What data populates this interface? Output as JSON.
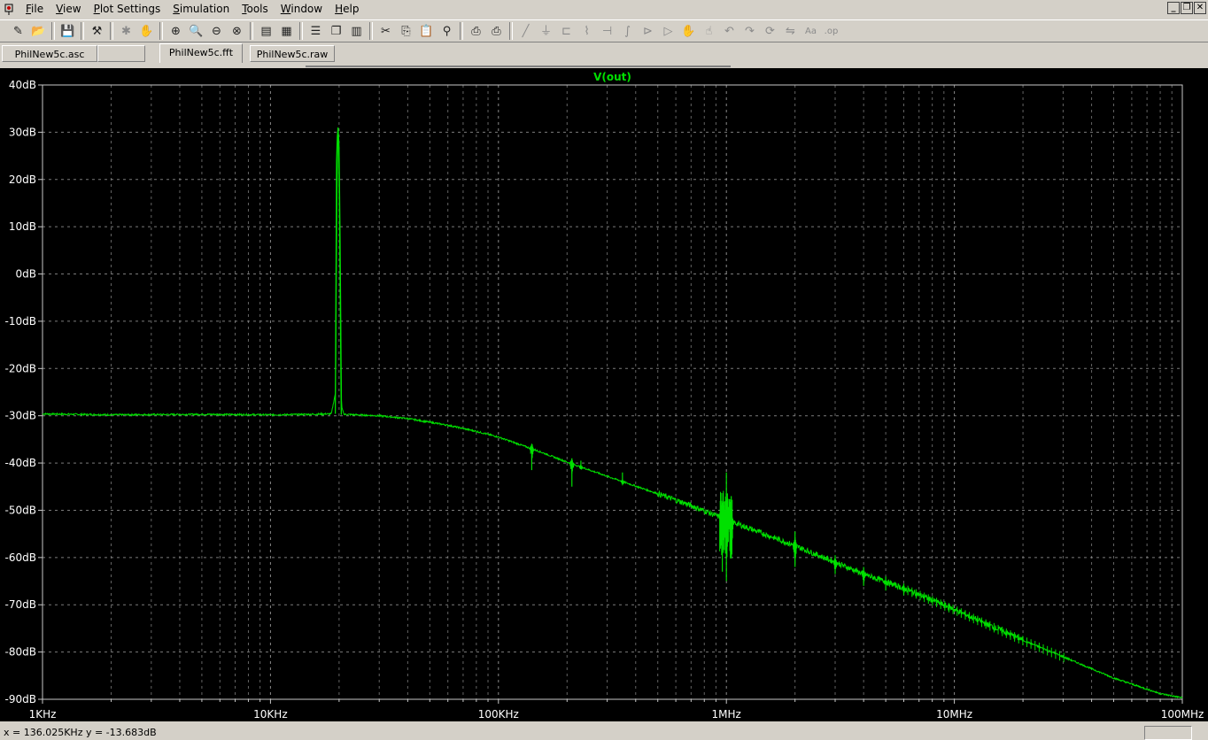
{
  "menu": {
    "items": [
      {
        "key": "F",
        "rest": "ile"
      },
      {
        "key": "V",
        "rest": "iew"
      },
      {
        "key": "P",
        "rest": "lot Settings"
      },
      {
        "key": "S",
        "rest": "imulation"
      },
      {
        "key": "T",
        "rest": "ools"
      },
      {
        "key": "W",
        "rest": "indow"
      },
      {
        "key": "H",
        "rest": "elp"
      }
    ]
  },
  "window_controls": [
    "_",
    "❐",
    "✕"
  ],
  "toolbar": {
    "icons": [
      "new-schematic-icon",
      "open-icon",
      "|",
      "save-icon",
      "|",
      "control-panel-icon",
      "|",
      "run-icon",
      "pan-icon",
      "|",
      "zoom-in-icon",
      "zoom-area-icon",
      "zoom-out-icon",
      "zoom-fit-icon",
      "|",
      "autorange-icon",
      "autorange-2-icon",
      "|",
      "tile-horizontal-icon",
      "cascade-icon",
      "tile-vertical-icon",
      "|",
      "cut-icon",
      "copy-icon",
      "paste-icon",
      "find-icon",
      "|",
      "print-setup-icon",
      "print-icon",
      "|",
      "wire-icon",
      "ground-icon",
      "label-icon",
      "resistor-icon",
      "capacitor-icon",
      "inductor-icon",
      "diode-icon",
      "component-icon",
      "move-icon",
      "drag-icon",
      "undo-icon",
      "redo-icon",
      "rotate-icon",
      "mirror-icon",
      "text-icon",
      "spice-directive-icon"
    ],
    "disabled_icons": [
      "run-icon",
      "pan-icon",
      "wire-icon",
      "ground-icon",
      "label-icon",
      "resistor-icon",
      "capacitor-icon",
      "inductor-icon",
      "diode-icon",
      "component-icon",
      "move-icon",
      "drag-icon",
      "undo-icon",
      "redo-icon",
      "rotate-icon",
      "mirror-icon",
      "text-icon",
      "spice-directive-icon"
    ]
  },
  "tabs": [
    {
      "label": "PhilNew5c.asc",
      "active": false
    },
    {
      "label": "",
      "active": false
    },
    {
      "label": "PhilNew5c.fft",
      "active": true
    },
    {
      "label": "PhilNew5c.raw",
      "active": false
    }
  ],
  "colors": {
    "trace": "#00e000",
    "grid": "#9a9a9a",
    "axis_frame": "#c8c8c8",
    "tick_label": "#ffffff",
    "background": "#000000"
  },
  "chart_data": {
    "type": "line",
    "title": "V(out)",
    "xscale": "log",
    "xlim": [
      1000,
      100000000
    ],
    "ylim": [
      -90,
      40
    ],
    "xlabel": "",
    "ylabel": "",
    "grid": true,
    "x_ticks": [
      {
        "value": 1000,
        "label": "1KHz"
      },
      {
        "value": 10000,
        "label": "10KHz"
      },
      {
        "value": 100000,
        "label": "100KHz"
      },
      {
        "value": 1000000,
        "label": "1MHz"
      },
      {
        "value": 10000000,
        "label": "10MHz"
      },
      {
        "value": 100000000,
        "label": "100MHz"
      }
    ],
    "y_ticks": [
      {
        "value": 40,
        "label": "40dB"
      },
      {
        "value": 30,
        "label": "30dB"
      },
      {
        "value": 20,
        "label": "20dB"
      },
      {
        "value": 10,
        "label": "10dB"
      },
      {
        "value": 0,
        "label": "0dB"
      },
      {
        "value": -10,
        "label": "-10dB"
      },
      {
        "value": -20,
        "label": "-20dB"
      },
      {
        "value": -30,
        "label": "-30dB"
      },
      {
        "value": -40,
        "label": "-40dB"
      },
      {
        "value": -50,
        "label": "-50dB"
      },
      {
        "value": -60,
        "label": "-60dB"
      },
      {
        "value": -70,
        "label": "-70dB"
      },
      {
        "value": -80,
        "label": "-80dB"
      },
      {
        "value": -90,
        "label": "-90dB"
      }
    ],
    "series": [
      {
        "name": "V(out)",
        "points": [
          [
            1000,
            -29.6
          ],
          [
            2000,
            -29.8
          ],
          [
            5000,
            -29.7
          ],
          [
            10000,
            -29.8
          ],
          [
            15000,
            -29.7
          ],
          [
            18500,
            -29.6
          ],
          [
            19300,
            -25
          ],
          [
            19600,
            18
          ],
          [
            19800,
            30
          ],
          [
            20000,
            28
          ],
          [
            20200,
            10
          ],
          [
            20500,
            -28
          ],
          [
            21000,
            -29.7
          ],
          [
            30000,
            -30
          ],
          [
            40000,
            -30.6
          ],
          [
            60000,
            -32
          ],
          [
            80000,
            -33.3
          ],
          [
            100000,
            -34.5
          ],
          [
            150000,
            -37.5
          ],
          [
            200000,
            -39.8
          ],
          [
            300000,
            -42.8
          ],
          [
            500000,
            -46.5
          ],
          [
            700000,
            -49
          ],
          [
            1000000,
            -52
          ],
          [
            2000000,
            -57.5
          ],
          [
            3000000,
            -61
          ],
          [
            4000000,
            -63.5
          ],
          [
            6000000,
            -66.5
          ],
          [
            10000000,
            -71
          ],
          [
            20000000,
            -77.5
          ],
          [
            30000000,
            -81
          ],
          [
            50000000,
            -85.5
          ],
          [
            80000000,
            -88.8
          ],
          [
            100000000,
            -89.7
          ]
        ],
        "spikes": [
          [
            140000,
            -36,
            -41.5
          ],
          [
            210000,
            -39,
            -45
          ],
          [
            230000,
            -39.5,
            -41
          ],
          [
            350000,
            -42,
            -44
          ],
          [
            960000,
            -49,
            -63
          ],
          [
            1000000,
            -42,
            -65
          ],
          [
            1050000,
            -47,
            -60
          ],
          [
            2000000,
            -54.5,
            -62
          ],
          [
            3000000,
            -59.5,
            -63.5
          ],
          [
            4000000,
            -62,
            -66
          ],
          [
            5000000,
            -64,
            -67
          ],
          [
            6000000,
            -65.5,
            -68
          ]
        ]
      }
    ]
  },
  "status": {
    "text": "x = 136.025KHz    y = -13.683dB"
  }
}
